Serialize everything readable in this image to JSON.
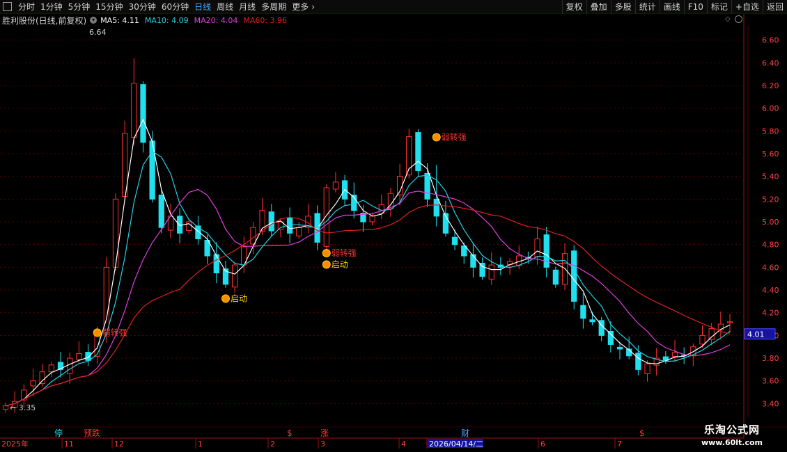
{
  "toolbar": {
    "tabs": [
      "分时",
      "1分钟",
      "5分钟",
      "15分钟",
      "30分钟",
      "60分钟",
      "日线",
      "周线",
      "月线",
      "多周期",
      "更多"
    ],
    "active_tab": "日线",
    "right_buttons": [
      "复权",
      "叠加",
      "多股",
      "统计",
      "画线",
      "F10",
      "标记",
      "+自选",
      "返回"
    ]
  },
  "legend": {
    "stock_name": "胜利股份(日线,前复权)",
    "ma5": "MA5: 4.11",
    "ma10": "MA10: 4.09",
    "ma20": "MA20: 4.04",
    "ma60": "MA60: 3.96",
    "colors": {
      "ma5": "#ffffff",
      "ma10": "#22d3e6",
      "ma20": "#e040e0",
      "ma60": "#e02020"
    }
  },
  "chart_data": {
    "type": "candlestick",
    "y_ticks": [
      "6.60",
      "6.40",
      "6.20",
      "6.00",
      "5.80",
      "5.60",
      "5.40",
      "5.20",
      "5.00",
      "4.80",
      "4.60",
      "4.40",
      "4.20",
      "4.00",
      "3.80",
      "3.60",
      "3.40"
    ],
    "ylim": [
      3.28,
      6.72
    ],
    "x_labels": [
      "2025年",
      "11",
      "12",
      "1",
      "2",
      "3",
      "4",
      "2026/04/14/二",
      "6",
      "7"
    ],
    "current_price": "4.01",
    "high_label": "6.64",
    "low_label": "3.35",
    "signals": [
      "弱转强",
      "启动",
      "弱转强",
      "启动",
      "弱转强"
    ],
    "bottom_markers": [
      "停",
      "预跌",
      "$",
      "涨",
      "财",
      "$"
    ],
    "colors": {
      "up": "#ff3030",
      "down": "#20e0f0",
      "grid": "#5a0000",
      "axis": "#a01010"
    },
    "close": [
      3.38,
      3.42,
      3.52,
      3.6,
      3.68,
      3.74,
      3.7,
      3.8,
      3.84,
      3.78,
      4.05,
      4.6,
      5.2,
      5.78,
      6.22,
      5.7,
      5.2,
      4.95,
      5.05,
      4.9,
      5.0,
      4.85,
      4.7,
      4.55,
      4.45,
      4.62,
      4.78,
      4.95,
      5.1,
      4.92,
      5.0,
      4.9,
      4.95,
      5.05,
      4.82,
      5.3,
      5.35,
      5.2,
      5.1,
      5.0,
      5.05,
      5.15,
      5.25,
      5.4,
      5.75,
      5.45,
      5.2,
      5.05,
      4.9,
      4.8,
      4.7,
      4.6,
      4.52,
      4.62,
      4.6,
      4.65,
      4.7,
      4.68,
      4.85,
      4.6,
      4.45,
      4.72,
      4.3,
      4.15,
      4.12,
      4.0,
      3.92,
      3.88,
      3.82,
      3.7,
      3.75,
      3.8,
      3.78,
      3.85,
      3.82,
      3.9,
      4.0,
      4.06,
      4.1,
      4.12
    ],
    "annotations": [
      {
        "text": "弱转强",
        "i": 10,
        "price": 4.0
      },
      {
        "text": "启动",
        "i": 24,
        "price": 4.3
      },
      {
        "text": "弱转强",
        "i": 35,
        "price": 4.7
      },
      {
        "text": "启动",
        "i": 35,
        "price": 4.6
      },
      {
        "text": "弱转强",
        "i": 47,
        "price": 5.72
      }
    ]
  },
  "watermark": {
    "line1": "乐淘公式网",
    "line2": "www.60lt.com"
  }
}
